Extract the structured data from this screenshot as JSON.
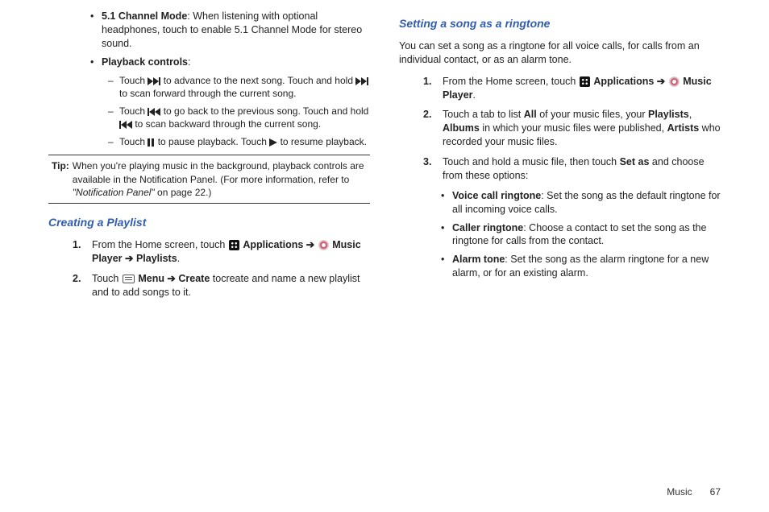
{
  "left": {
    "b1_label": "5.1 Channel Mode",
    "b1_text": ": When listening with optional headphones, touch to enable 5.1 Channel Mode for stereo sound.",
    "b2_label": "Playback controls",
    "b2_colon": ":",
    "pc1a": "Touch ",
    "pc1b": " to advance to the next song. Touch and hold ",
    "pc1c": " to scan forward through the current song.",
    "pc2a": "Touch ",
    "pc2b": " to go back to the previous song. Touch and hold ",
    "pc2c": " to scan backward through the current song.",
    "pc3a": "Touch ",
    "pc3b": " to pause playback. Touch ",
    "pc3c": " to resume playback.",
    "tip_label": "Tip:",
    "tip_a": "When you're playing music in the background, playback controls are available in the Notification Panel. (For more information, refer to ",
    "tip_it": "\"Notification Panel\"",
    "tip_b": " on page 22.)",
    "h_playlist": "Creating a Playlist",
    "pl1a": "From the Home screen, touch ",
    "pl1_apps": "Applications ➔ ",
    "pl1_mp": "Music Player ➔ Playlists",
    "pl1_end": ".",
    "pl2a": "Touch ",
    "pl2b": "Menu ➔ Create",
    "pl2c": " tocreate and name a new playlist and to add songs to it."
  },
  "right": {
    "h_ring": "Setting a song as a ringtone",
    "intro": "You can set a song as a ringtone for all voice calls, for calls from an individual contact, or as an alarm tone.",
    "r1a": "From the Home screen, touch ",
    "r1_apps": "Applications ➔ ",
    "r1_mp": "Music Player",
    "r1_end": ".",
    "r2a": "Touch a tab to list ",
    "r2_all": "All",
    "r2b": " of your music files, your ",
    "r2_pl": "Playlists",
    "r2c": ", ",
    "r2_al": "Albums",
    "r2d": " in which your music files were published, ",
    "r2_ar": "Artists",
    "r2e": " who recorded your music files.",
    "r3a": "Touch and hold a music file, then touch ",
    "r3_set": "Set as",
    "r3b": " and choose from these options:",
    "opt1_l": "Voice call ringtone",
    "opt1_t": ": Set the song as the default ringtone for all incoming voice calls.",
    "opt2_l": "Caller ringtone",
    "opt2_t": ": Choose a contact to set the song as the ringtone for calls from the contact.",
    "opt3_l": "Alarm tone",
    "opt3_t": ": Set the song as the alarm ringtone for a new alarm, or for an existing alarm."
  },
  "footer": {
    "section": "Music",
    "page": "67"
  },
  "nums": {
    "n1": "1.",
    "n2": "2.",
    "n3": "3."
  },
  "glyphs": {
    "dot": "•",
    "dash": "–"
  }
}
